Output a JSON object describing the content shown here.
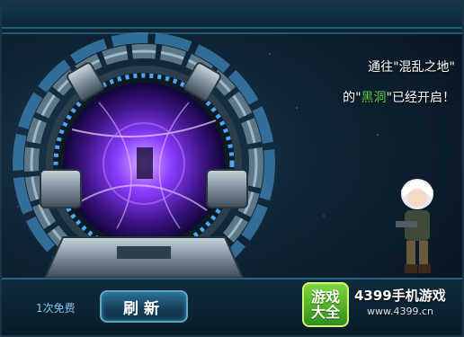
{
  "announcement": {
    "line1": "通往\"混乱之地\"",
    "line2_prefix": "的\"",
    "line2_highlight": "黑洞",
    "line2_suffix": "\"已经开启！"
  },
  "bottom": {
    "free_text": "1次免费",
    "refresh_label": "刷新"
  },
  "watermark": {
    "badge_line1": "游戏",
    "badge_line2": "大全",
    "title": "4399手机游戏",
    "url": "www.4399.cn"
  },
  "colors": {
    "highlight": "#5ad24a",
    "portal_core": "#8a3cff",
    "accent": "#2f7ea3"
  },
  "icons": [
    "portal-icon",
    "character-sprite"
  ]
}
